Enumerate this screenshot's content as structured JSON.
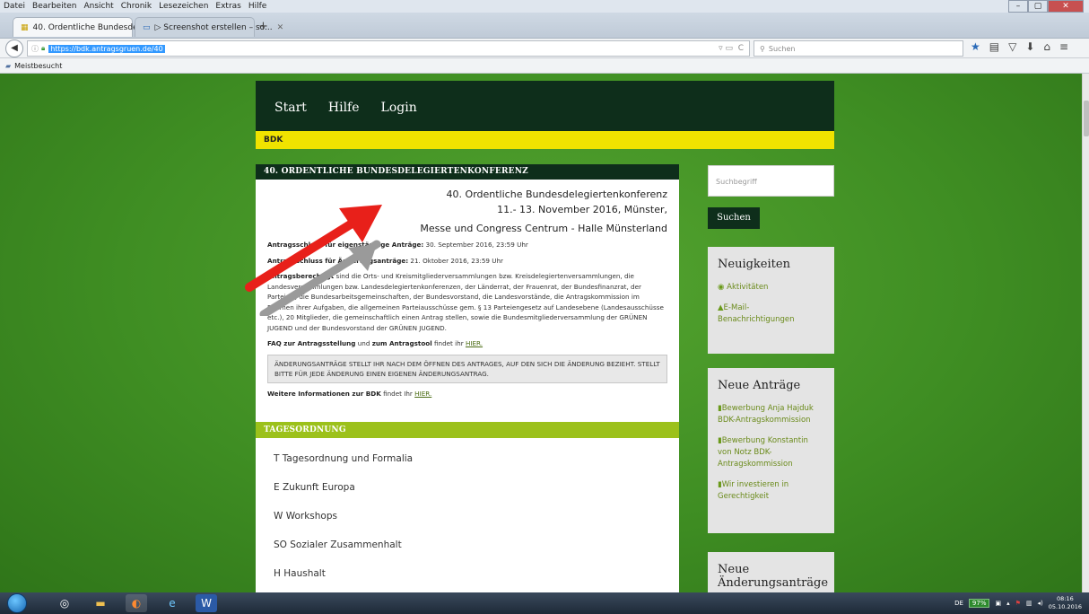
{
  "browser": {
    "menu": [
      "Datei",
      "Bearbeiten",
      "Ansicht",
      "Chronik",
      "Lesezeichen",
      "Extras",
      "Hilfe"
    ],
    "tabs": [
      {
        "label": "40. Ordentliche Bundesdel...",
        "active": true
      },
      {
        "label": "▷ Screenshot erstellen – so...",
        "active": false
      }
    ],
    "url": "https://bdk.antragsgruen.de/40",
    "search_placeholder": "Suchen",
    "bookmark": "Meistbesucht"
  },
  "site": {
    "nav": [
      "Start",
      "Hilfe",
      "Login"
    ],
    "breadcrumb": "BDK",
    "panel_title": "40. ORDENTLICHE BUNDESDELEGIERTENKONFERENZ",
    "intro": {
      "line1": "40. Ordentliche Bundesdelegiertenkonferenz",
      "line2": "11.- 13. November 2016, Münster,",
      "line3": "Messe und Congress Centrum - Halle Münsterland",
      "deadline1_label": "Antragsschluss für eigenständige Anträge:",
      "deadline1_value": " 30. September 2016, 23:59 Uhr",
      "deadline2_label": "Antragsschluss für Änderungsanträge:",
      "deadline2_value": " 21. Oktober 2016, 23:59 Uhr",
      "eligible_label": "Antragsberechtigt",
      "eligible_text": " sind die Orts- und Kreismitgliederversammlungen bzw. Kreisdelegiertenversammlungen, die Landesversammlungen bzw. Landesdelegiertenkonferenzen, der Länderrat, der Frauenrat, der Bundesfinanzrat, der Parteirat, die Bundesarbeitsgemeinschaften, der Bundesvorstand, die Landesvorstände, die Antragskommission im Rahmen ihrer Aufgaben, die allgemeinen Parteiausschüsse gem. § 13 Parteiengesetz auf Landesebene (Landesausschüsse etc.), 20 Mitglieder, die gemeinschaftlich einen Antrag stellen, sowie die Bundesmitgliederversammlung der GRÜNEN JUGEND und der Bundesvorstand der GRÜNEN JUGEND.",
      "faq_pre": "FAQ zur Antragsstellung",
      "faq_mid": " und ",
      "faq_bold2": "zum Antragstool",
      "faq_post": " findet ihr ",
      "faq_link": "HIER.",
      "notice": "Änderungsanträge stellt ihr nach dem Öffnen des Antrages, auf den sich die Änderung bezieht. Stellt bitte für jede Änderung einen eigenen Änderungsantrag.",
      "more_label": "Weitere Informationen zur BDK",
      "more_post": " findet Ihr ",
      "more_link": "HIER."
    },
    "agenda_title": "TAGESORDNUNG",
    "agenda": [
      "T Tagesordnung und Formalia",
      "E Zukunft Europa",
      "W Workshops",
      "SO Sozialer Zusammenhalt",
      "H Haushalt"
    ],
    "sidebar": {
      "search_placeholder": "Suchbegriff",
      "search_button": "Suchen",
      "news_title": "Neuigkeiten",
      "news_items": [
        "Aktivitäten",
        "E-Mail-Benachrichtigungen"
      ],
      "motions_title": "Neue Anträge",
      "motions": [
        "Bewerbung Anja Hajduk BDK-Antragskommission",
        "Bewerbung Konstantin von Notz BDK-Antragskommission",
        "Wir investieren in Gerechtigkeit"
      ],
      "amendments_title": "Neue Änderungsanträge"
    }
  },
  "taskbar": {
    "lang": "DE",
    "battery": "97%",
    "time": "08:16",
    "date": "05.10.2016"
  },
  "colors": {
    "header_dark": "#0e2e1b",
    "crumb_yellow": "#f0e300",
    "agenda_green": "#9cc11b",
    "arrow_red": "#e8201a"
  }
}
